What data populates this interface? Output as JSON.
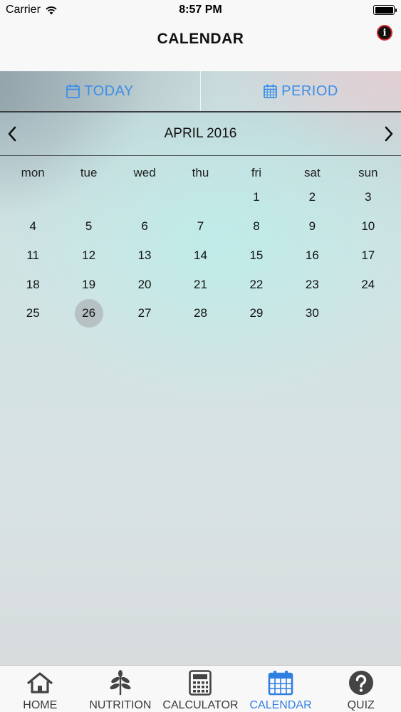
{
  "status_bar": {
    "carrier": "Carrier",
    "time": "8:57 PM",
    "icons": [
      "wifi-icon",
      "battery-icon"
    ]
  },
  "nav": {
    "title": "CALENDAR",
    "info_icon": "info-icon",
    "info_glyph": "i"
  },
  "mode_tabs": [
    {
      "label": "TODAY",
      "icon": "calendar-icon"
    },
    {
      "label": "PERIOD",
      "icon": "calendar-grid-icon"
    }
  ],
  "calendar": {
    "month_label": "APRIL 2016",
    "weekdays": [
      "mon",
      "tue",
      "wed",
      "thu",
      "fri",
      "sat",
      "sun"
    ],
    "leading_blank_days": 4,
    "days": [
      "1",
      "2",
      "3",
      "4",
      "5",
      "6",
      "7",
      "8",
      "9",
      "10",
      "11",
      "12",
      "13",
      "14",
      "15",
      "16",
      "17",
      "18",
      "19",
      "20",
      "21",
      "22",
      "23",
      "24",
      "25",
      "26",
      "27",
      "28",
      "29",
      "30"
    ],
    "selected_day": "26"
  },
  "tab_bar": {
    "items": [
      {
        "label": "HOME",
        "icon": "home-icon"
      },
      {
        "label": "NUTRITION",
        "icon": "leaf-icon"
      },
      {
        "label": "CALCULATOR",
        "icon": "calculator-icon"
      },
      {
        "label": "CALENDAR",
        "icon": "calendar-icon"
      },
      {
        "label": "QUIZ",
        "icon": "question-icon"
      }
    ],
    "active_index": 3
  },
  "colors": {
    "accent": "#3a8ee8",
    "tab_active": "#2f7fe0",
    "info_ring": "#d6262a"
  }
}
